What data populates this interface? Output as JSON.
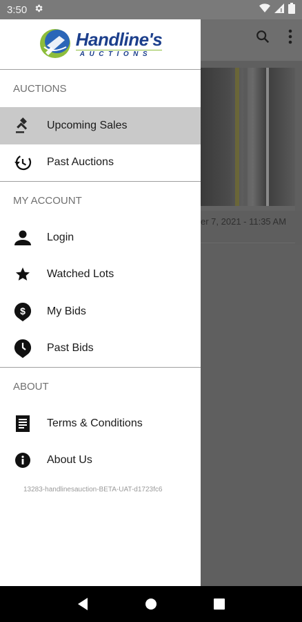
{
  "status_bar": {
    "time": "3:50"
  },
  "brand": {
    "name": "Handline's",
    "sub": "AUCTIONS",
    "colors": {
      "blue": "#1c3f8c",
      "green": "#8dbd3b"
    }
  },
  "background": {
    "date_text": "er 7, 2021 - 11:35 AM"
  },
  "drawer": {
    "sections": [
      {
        "title": "AUCTIONS",
        "items": [
          {
            "label": "Upcoming Sales",
            "icon": "gavel-icon",
            "selected": true
          },
          {
            "label": "Past Auctions",
            "icon": "history-icon"
          }
        ]
      },
      {
        "title": "MY ACCOUNT",
        "items": [
          {
            "label": "Login",
            "icon": "person-icon"
          },
          {
            "label": "Watched Lots",
            "icon": "star-icon"
          },
          {
            "label": "My Bids",
            "icon": "dollar-pin-icon"
          },
          {
            "label": "Past Bids",
            "icon": "clock-pin-icon"
          }
        ]
      },
      {
        "title": "ABOUT",
        "items": [
          {
            "label": "Terms & Conditions",
            "icon": "document-icon"
          },
          {
            "label": "About Us",
            "icon": "info-icon"
          }
        ]
      }
    ],
    "build_info": "13283-handlinesauction-BETA-UAT-d1723fc6"
  }
}
